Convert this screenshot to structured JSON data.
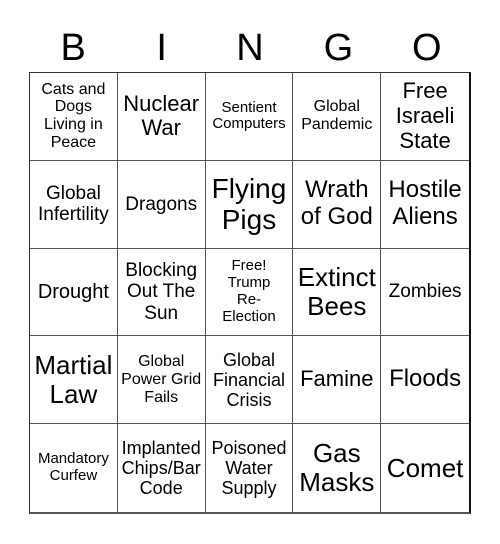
{
  "header": {
    "letters": [
      "B",
      "I",
      "N",
      "G",
      "O"
    ]
  },
  "cells": [
    "Cats and Dogs Living in Peace",
    "Nuclear War",
    "Sentient Computers",
    "Global Pandemic",
    "Free Israeli State",
    "Global Infertility",
    "Dragons",
    "Flying Pigs",
    "Wrath of God",
    "Hostile Aliens",
    "Drought",
    "Blocking Out The Sun",
    "Free! Trump Re-Election",
    "Extinct Bees",
    "Zombies",
    "Martial Law",
    "Global Power Grid Fails",
    "Global Financial Crisis",
    "Famine",
    "Floods",
    "Mandatory Curfew",
    "Implanted Chips/Bar Code",
    "Poisoned Water Supply",
    "Gas Masks",
    "Comet"
  ]
}
